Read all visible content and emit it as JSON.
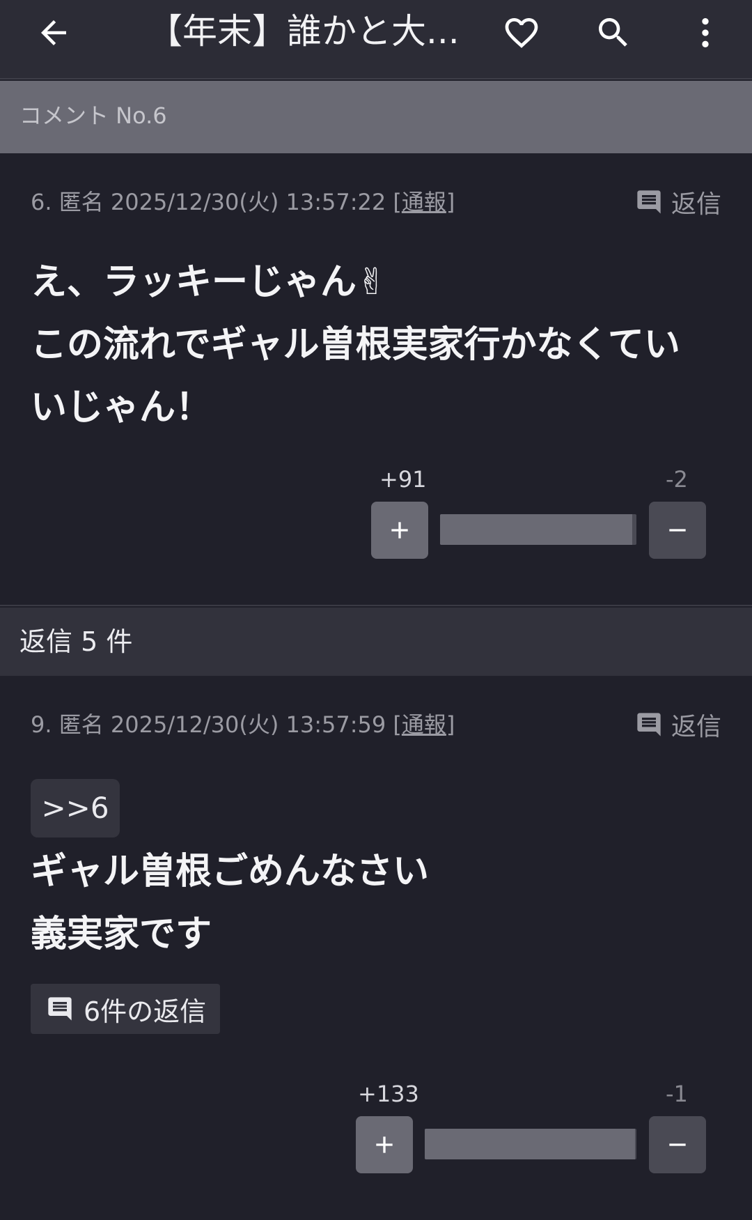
{
  "app_bar": {
    "title": "【年末】誰かと大..."
  },
  "section_header": "コメント No.6",
  "comments": [
    {
      "number": "6.",
      "author": "匿名",
      "timestamp": "2025/12/30(火) 13:57:22",
      "report_open": "[",
      "report": "通報",
      "report_close": "]",
      "reply_label": "返信",
      "lines": [
        "え、ラッキーじゃん✌",
        "この流れでギャル曽根実家行かなくてい",
        "いじゃん！"
      ],
      "votes": {
        "plus": "+91",
        "minus": "-2",
        "plus_ratio": 0.978
      }
    },
    {
      "number": "9.",
      "author": "匿名",
      "timestamp": "2025/12/30(火) 13:57:59",
      "report_open": "[",
      "report": "通報",
      "report_close": "]",
      "reply_label": "返信",
      "anchor": ">>6",
      "lines": [
        "ギャル曽根ごめんなさい",
        "義実家です"
      ],
      "replies_button": "6件の返信",
      "votes": {
        "plus": "+133",
        "minus": "-1",
        "plus_ratio": 0.993
      }
    }
  ],
  "replies_header": "返信 5 件",
  "icons": {
    "back": "arrow-left-icon",
    "favorite": "heart-outline-icon",
    "search": "search-icon",
    "menu": "more-vert-icon",
    "reply": "comment-icon",
    "plus": "plus-icon",
    "minus": "minus-icon"
  },
  "colors": {
    "background": "#20202a",
    "app_bar": "#2c2c36",
    "section_header": "#6a6a74",
    "vote_plus_button": "#6a6a74",
    "vote_minus_button": "#4a4a54"
  }
}
